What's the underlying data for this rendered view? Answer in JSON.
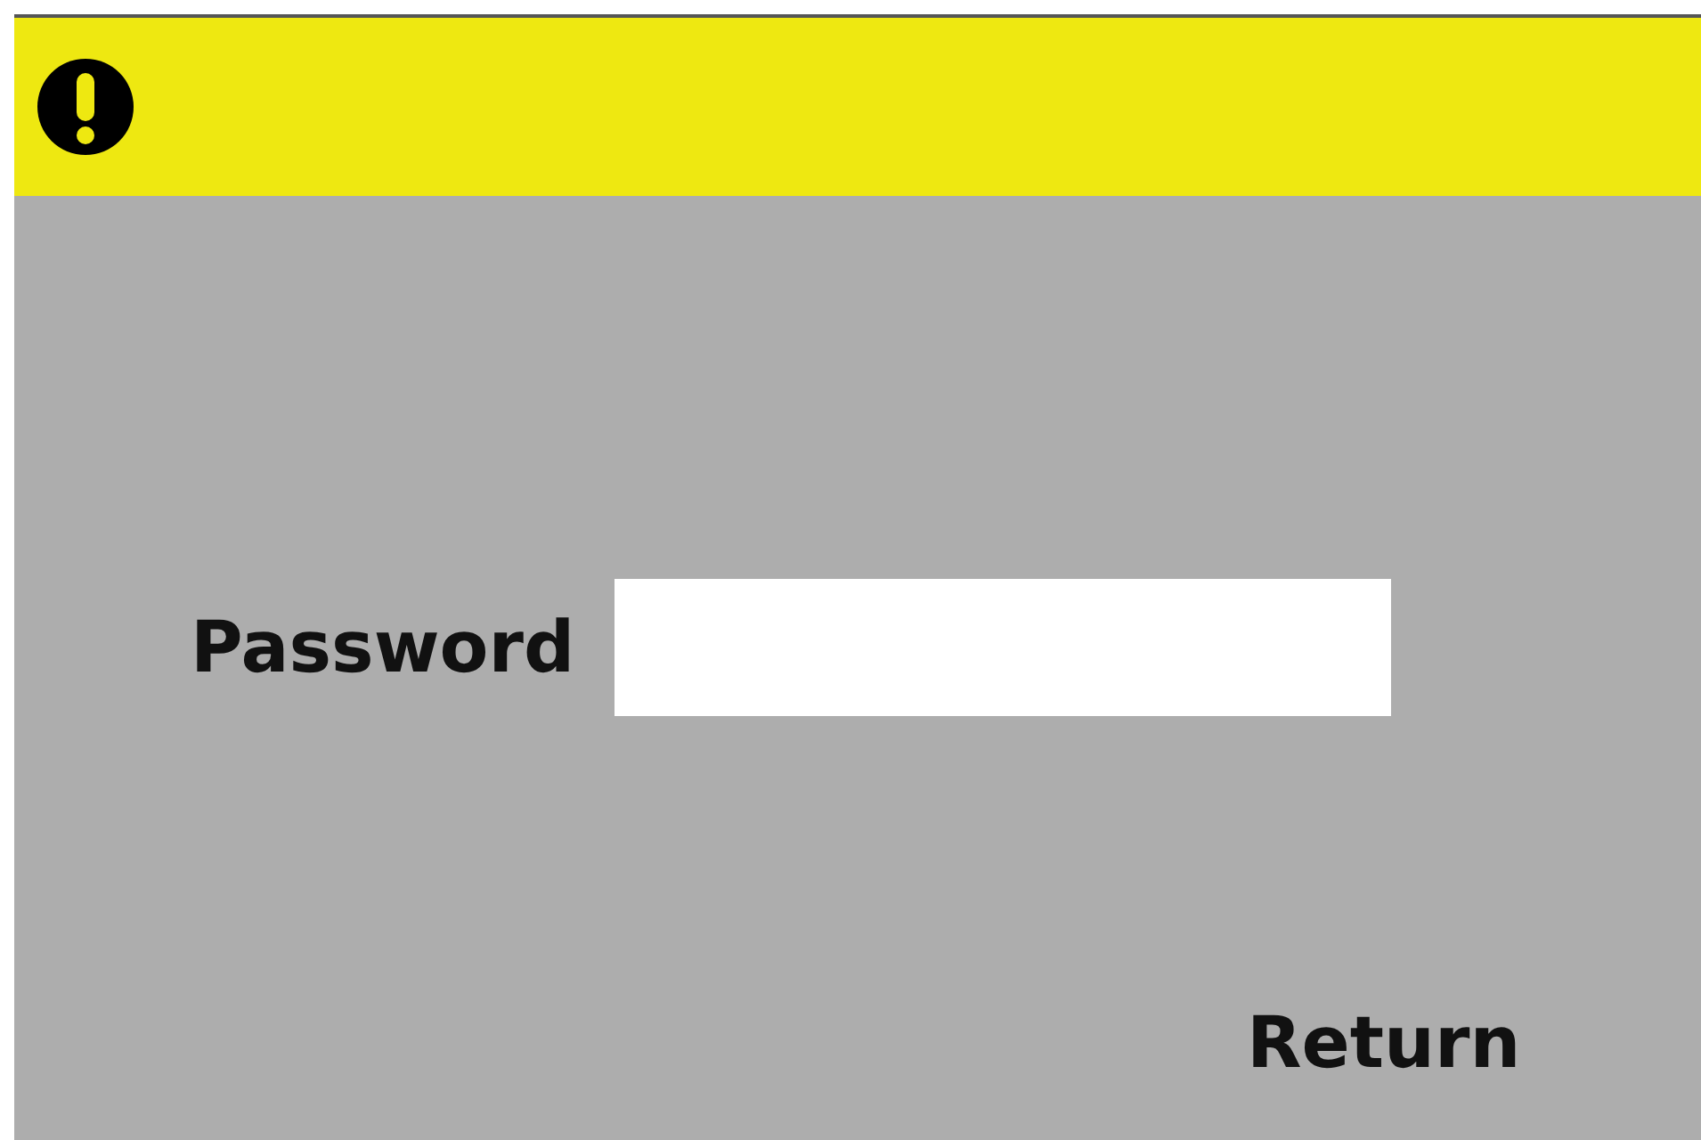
{
  "alert_bar": {
    "kind": "warning"
  },
  "password": {
    "label": "Password"
  },
  "buttons": [
    {
      "label": "Return"
    }
  ]
}
